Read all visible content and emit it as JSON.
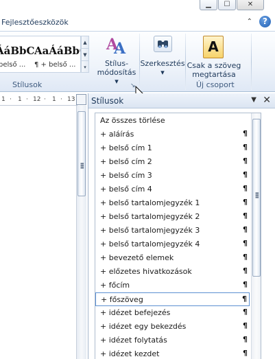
{
  "window": {
    "minimize_glyph": "▁",
    "maximize_glyph": "☐",
    "close_glyph": "✕"
  },
  "tabs": {
    "developer_tab": "Fejlesztőeszközök",
    "collapse_glyph": "⌃",
    "help_glyph": "?"
  },
  "ribbon": {
    "styles_group": {
      "label": "Stílusok",
      "gallery": [
        {
          "sample": "ÁáBbC",
          "caption": "belső ..."
        },
        {
          "sample": "AaÁáBbC",
          "caption": "¶ + belső ..."
        }
      ],
      "scroll_up": "▲",
      "scroll_down": "▼",
      "more": "▾"
    },
    "style_change": {
      "label_line1": "Stílus-",
      "label_line2": "módosítás ▾"
    },
    "editing": {
      "label": "Szerkesztés",
      "dropdown": "▾"
    },
    "new_group": {
      "label": "Új csoport",
      "button_line1": "Csak a szöveg",
      "button_line2": "megtartása",
      "icon_letter": "A"
    },
    "dialog_launcher": "↘"
  },
  "ruler": {
    "ticks": [
      "1",
      "·",
      "1",
      "·",
      "12",
      "·",
      "1",
      "·",
      "13"
    ]
  },
  "styles_pane": {
    "title": "Stílusok",
    "menu_glyph": "▼",
    "close_glyph": "✕",
    "clear_all": "Az összes törlése",
    "items": [
      {
        "label": "+ aláírás",
        "mark": "¶"
      },
      {
        "label": "+ belső cím 1",
        "mark": "¶"
      },
      {
        "label": "+ belső cím 2",
        "mark": "¶"
      },
      {
        "label": "+ belső cím 3",
        "mark": "¶"
      },
      {
        "label": "+ belső cím 4",
        "mark": "¶"
      },
      {
        "label": "+ belső tartalomjegyzék 1",
        "mark": "¶"
      },
      {
        "label": "+ belső tartalomjegyzék 2",
        "mark": "¶"
      },
      {
        "label": "+ belső tartalomjegyzék 3",
        "mark": "¶"
      },
      {
        "label": "+ belső tartalomjegyzék 4",
        "mark": "¶"
      },
      {
        "label": "+ bevezető elemek",
        "mark": "¶"
      },
      {
        "label": "+ előzetes hivatkozások",
        "mark": "¶"
      },
      {
        "label": "+ főcím",
        "mark": "¶"
      },
      {
        "label": "+ főszöveg",
        "mark": "¶"
      },
      {
        "label": "+ idézet befejezés",
        "mark": "¶"
      },
      {
        "label": "+ idézet egy bekezdés",
        "mark": "¶"
      },
      {
        "label": "+ idézet folytatás",
        "mark": "¶"
      },
      {
        "label": "+ idézet kezdet",
        "mark": "¶"
      }
    ],
    "selected_index": 12
  },
  "colors": {
    "ribbon_text": "#1e395b",
    "selection_border": "#5b8fd1",
    "pane_border": "#aebcce"
  }
}
